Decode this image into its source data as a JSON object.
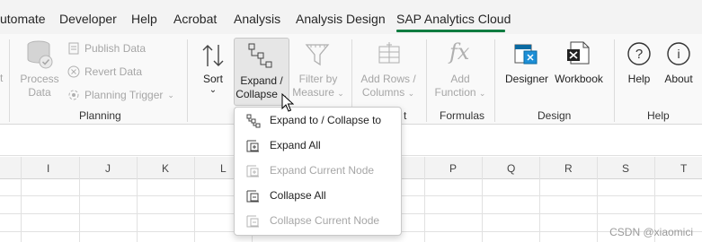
{
  "tabs": [
    {
      "label": "utomate"
    },
    {
      "label": "Developer"
    },
    {
      "label": "Help"
    },
    {
      "label": "Acrobat"
    },
    {
      "label": "Analysis"
    },
    {
      "label": "Analysis Design"
    },
    {
      "label": "SAP Analytics Cloud"
    }
  ],
  "ribbon": {
    "cut_label": "t",
    "process_data": {
      "line1": "Process",
      "line2": "Data"
    },
    "publish_data": "Publish Data",
    "revert_data": "Revert Data",
    "planning_trigger": "Planning Trigger",
    "planning_group": "Planning",
    "sort": "Sort",
    "expand_collapse": {
      "line1": "Expand /",
      "line2": "Collapse"
    },
    "filter_by_measure": {
      "line1": "Filter by",
      "line2": "Measure"
    },
    "add_rows_columns": {
      "line1": "Add Rows /",
      "line2": "Columns"
    },
    "add_function": {
      "line1": "Add",
      "line2": "Function"
    },
    "formulas_group": "Formulas",
    "partial_group": "t",
    "designer": "Designer",
    "workbook": "Workbook",
    "design_group": "Design",
    "help": "Help",
    "about": "About",
    "help_group": "Help"
  },
  "dropdown": {
    "items": [
      {
        "label": "Expand to / Collapse to",
        "enabled": true
      },
      {
        "label": "Expand All",
        "enabled": true
      },
      {
        "label": "Expand Current Node",
        "enabled": false
      },
      {
        "label": "Collapse All",
        "enabled": true
      },
      {
        "label": "Collapse Current Node",
        "enabled": false
      }
    ]
  },
  "grid": {
    "columns": [
      "I",
      "J",
      "K",
      "L",
      "P",
      "Q",
      "R",
      "S",
      "T"
    ]
  },
  "watermark": "CSDN @xiaomici",
  "colors": {
    "accent": "#107c41",
    "disabled": "#a6a6a6"
  }
}
